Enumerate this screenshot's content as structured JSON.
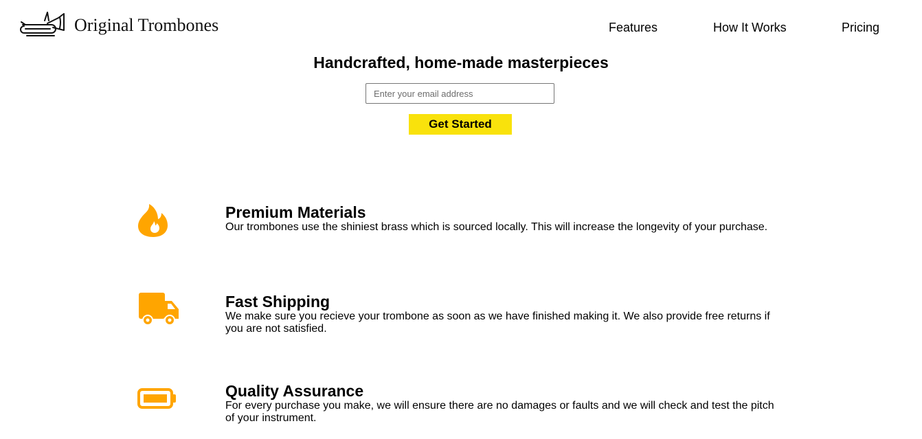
{
  "header": {
    "logo_text": "Original Trombones",
    "logo_icon": "trombone-icon",
    "nav": {
      "features": "Features",
      "how_it_works": "How It Works",
      "pricing": "Pricing"
    }
  },
  "hero": {
    "title": "Handcrafted, home-made masterpieces",
    "email_placeholder": "Enter your email address",
    "cta_label": "Get Started"
  },
  "colors": {
    "accent_icon": "#ffa500",
    "cta_background": "#f9e20c"
  },
  "features": [
    {
      "icon": "fire-icon",
      "title": "Premium Materials",
      "description": "Our trombones use the shiniest brass which is sourced locally. This will increase the longevity of your purchase."
    },
    {
      "icon": "truck-icon",
      "title": "Fast Shipping",
      "description": "We make sure you recieve your trombone as soon as we have finished making it. We also provide free returns if you are not satisfied."
    },
    {
      "icon": "battery-icon",
      "title": "Quality Assurance",
      "description": "For every purchase you make, we will ensure there are no damages or faults and we will check and test the pitch of your instrument."
    }
  ]
}
